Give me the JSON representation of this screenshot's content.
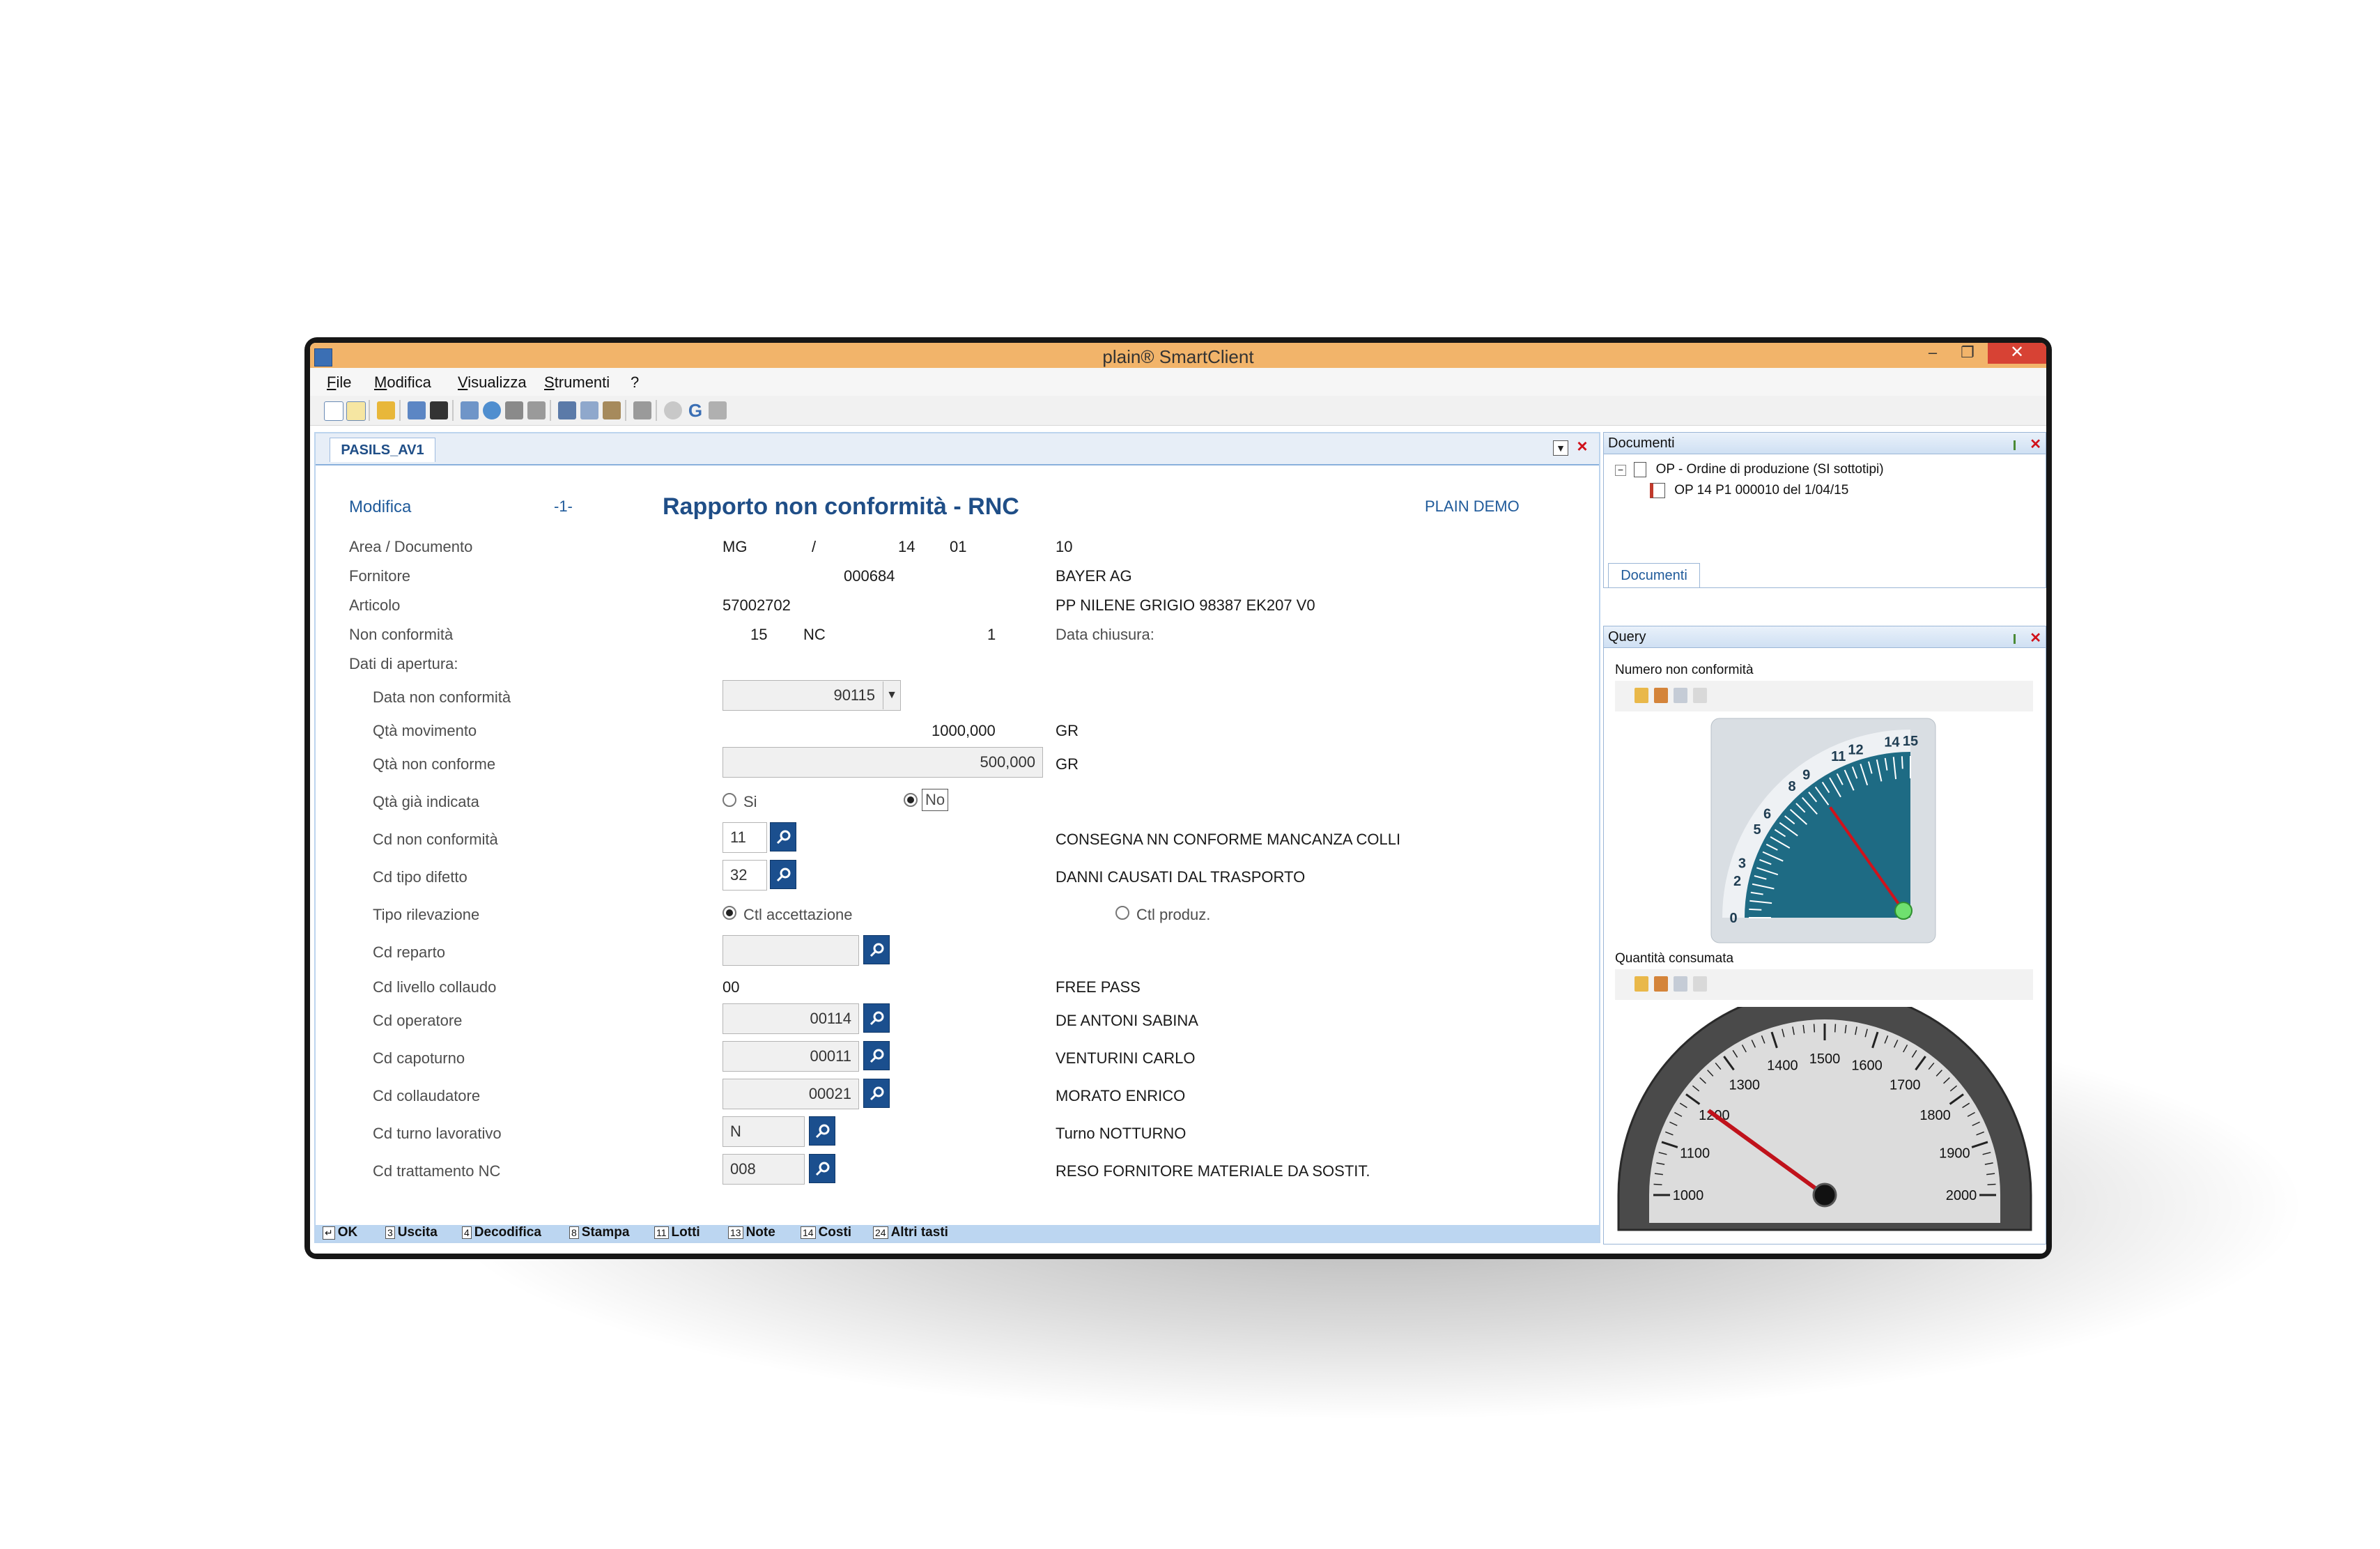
{
  "window": {
    "title": "plain® SmartClient"
  },
  "menu": [
    "File",
    "Modifica",
    "Visualizza",
    "Strumenti",
    "?"
  ],
  "form": {
    "tab": "PASILS_AV1",
    "mode": "Modifica",
    "page": "-1-",
    "title": "Rapporto non conformità - RNC",
    "company": "PLAIN DEMO",
    "rows": {
      "area_label": "Area / Documento",
      "area_v1": "MG",
      "area_v2": "/",
      "area_v3": "14",
      "area_v4": "01",
      "area_v5": "10",
      "fornitore_label": "Fornitore",
      "fornitore_code": "000684",
      "fornitore_name": "BAYER AG",
      "articolo_label": "Articolo",
      "articolo_code": "57002702",
      "articolo_desc": "PP NILENE GRIGIO 98387 EK207 V0",
      "nc_label": "Non conformità",
      "nc_v1": "15",
      "nc_v2": "NC",
      "nc_v3": "1",
      "data_chiusura": "Data chiusura:",
      "dati_apertura": "Dati di apertura:",
      "data_nc_label": "Data non conformità",
      "data_nc_value": "90115",
      "qta_mov_label": "Qtà movimento",
      "qta_mov_value": "1000,000",
      "qta_mov_unit": "GR",
      "qta_nc_label": "Qtà non conforme",
      "qta_nc_value": "500,000",
      "qta_nc_unit": "GR",
      "qta_ind_label": "Qtà già indicata",
      "qta_ind_si": "Si",
      "qta_ind_no": "No",
      "cd_nc_label": "Cd non conformità",
      "cd_nc_value": "11",
      "cd_nc_desc": "CONSEGNA NN CONFORME MANCANZA COLLI",
      "cd_tipo_label": "Cd tipo difetto",
      "cd_tipo_value": "32",
      "cd_tipo_desc": "DANNI CAUSATI DAL TRASPORTO",
      "tipo_ril_label": "Tipo rilevazione",
      "tipo_ril_opt1": "Ctl accettazione",
      "tipo_ril_opt2": "Ctl produz.",
      "cd_reparto_label": "Cd reparto",
      "cd_reparto_value": "",
      "cd_livello_label": "Cd livello collaudo",
      "cd_livello_value": "00",
      "cd_livello_desc": "FREE PASS",
      "cd_operatore_label": "Cd operatore",
      "cd_operatore_value": "00114",
      "cd_operatore_desc": "DE ANTONI SABINA",
      "cd_capoturno_label": "Cd capoturno",
      "cd_capoturno_value": "00011",
      "cd_capoturno_desc": "VENTURINI CARLO",
      "cd_collaudatore_label": "Cd collaudatore",
      "cd_collaudatore_value": "00021",
      "cd_collaudatore_desc": "MORATO ENRICO",
      "cd_turno_label": "Cd turno lavorativo",
      "cd_turno_value": "N",
      "cd_turno_desc": "Turno NOTTURNO",
      "cd_tratt_label": "Cd trattamento NC",
      "cd_tratt_value": "008",
      "cd_tratt_desc": "RESO FORNITORE MATERIALE DA SOSTIT."
    },
    "fkeys": [
      {
        "key": "↵",
        "label": "OK"
      },
      {
        "key": "3",
        "label": "Uscita"
      },
      {
        "key": "4",
        "label": "Decodifica"
      },
      {
        "key": "8",
        "label": "Stampa"
      },
      {
        "key": "11",
        "label": "Lotti"
      },
      {
        "key": "13",
        "label": "Note"
      },
      {
        "key": "14",
        "label": "Costi"
      },
      {
        "key": "24",
        "label": "Altri tasti"
      }
    ]
  },
  "documenti": {
    "header": "Documenti",
    "node1": "OP - Ordine di produzione (SI sottotipi)",
    "node2": "OP 14 P1 000010 del 1/04/15",
    "tab": "Documenti"
  },
  "query": {
    "header": "Query",
    "gauge1_title": "Numero non conformità",
    "gauge1_value": 9,
    "gauge1_ticks": [
      "0",
      "2",
      "3",
      "5",
      "6",
      "8",
      "9",
      "11",
      "12",
      "14",
      "15"
    ],
    "gauge2_title": "Quantità consumata",
    "gauge2_value": 1200,
    "gauge2_ticks": [
      "1000",
      "1100",
      "1200",
      "1300",
      "1400",
      "1500",
      "1600",
      "1700",
      "1800",
      "1900",
      "2000"
    ]
  },
  "colors": {
    "accent": "#1f5a9a",
    "titlebar": "#f2b46a",
    "close": "#d74234"
  }
}
